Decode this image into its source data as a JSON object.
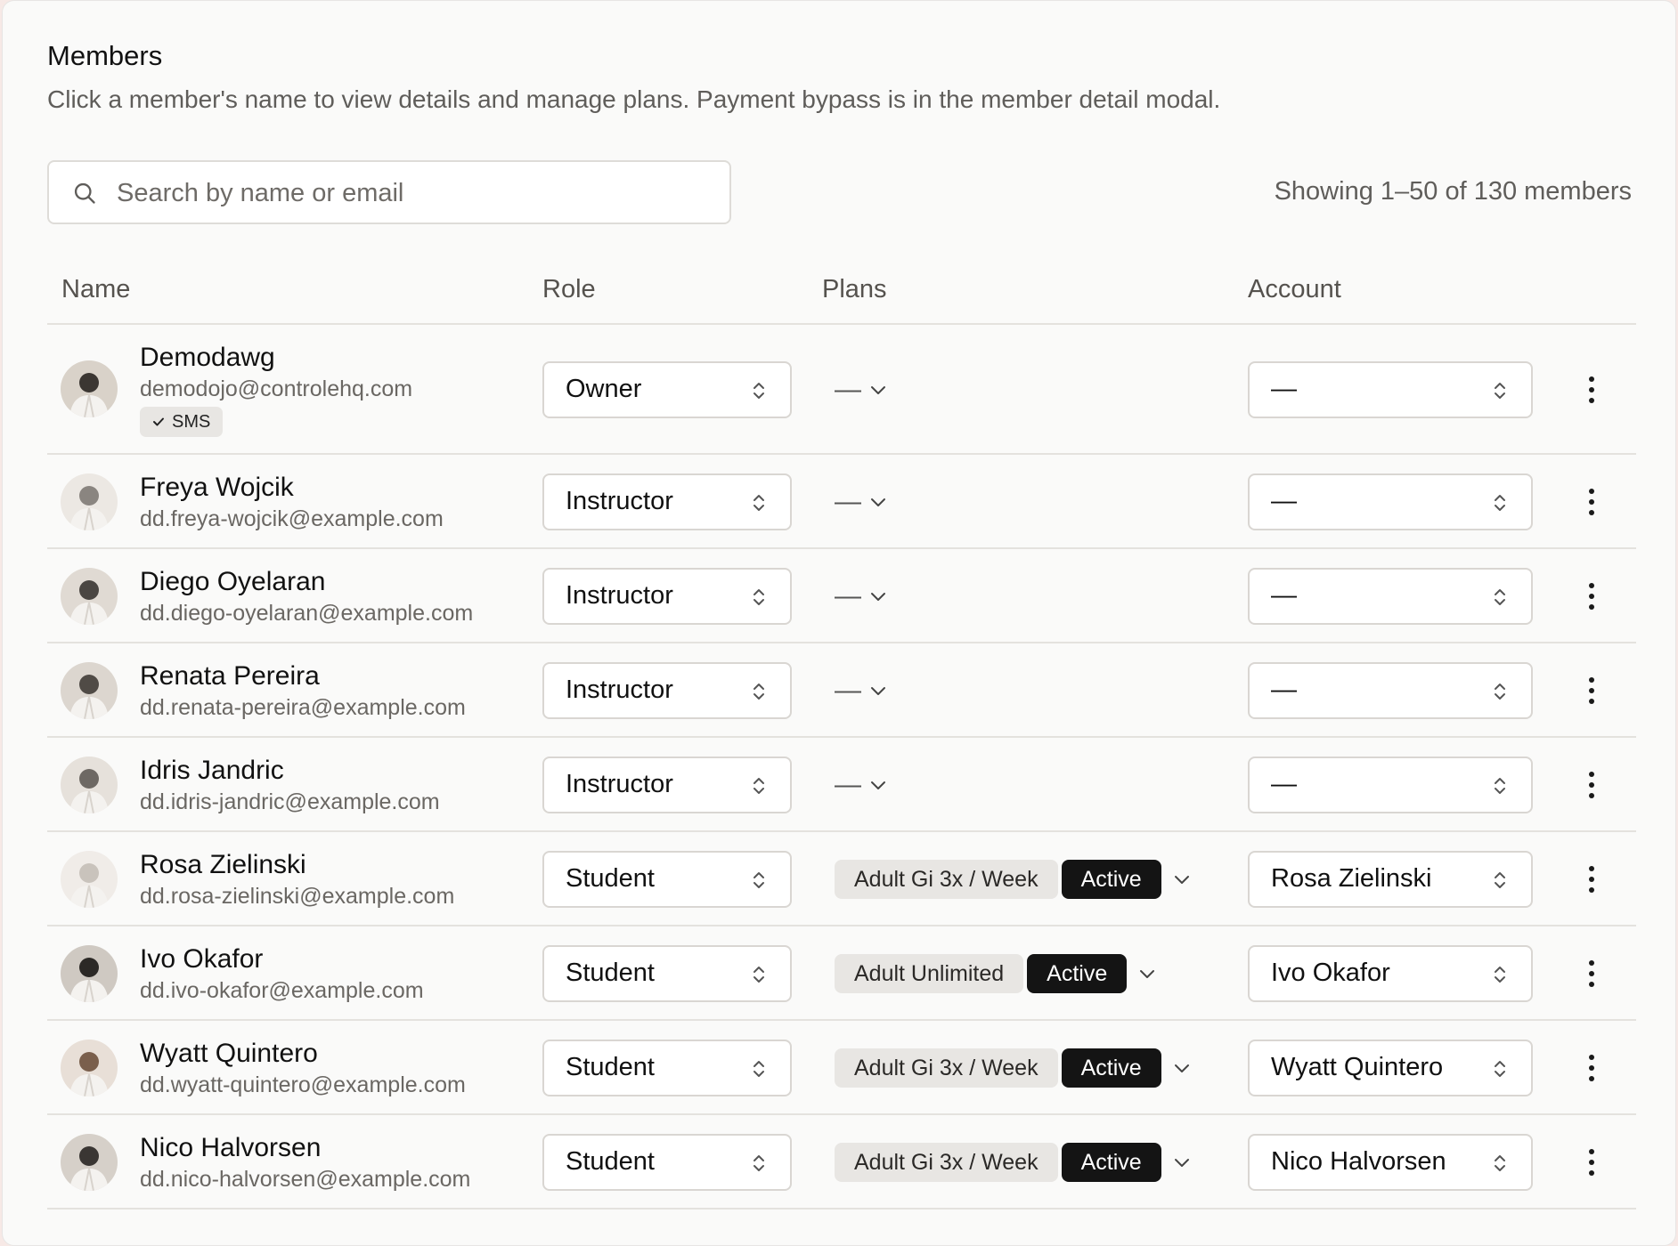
{
  "page": {
    "title": "Members",
    "subtitle": "Click a member's name to view details and manage plans. Payment bypass is in the member detail modal."
  },
  "search": {
    "placeholder": "Search by name or email",
    "value": ""
  },
  "count_text": "Showing 1–50 of 130 members",
  "columns": {
    "name": "Name",
    "role": "Role",
    "plans": "Plans",
    "account": "Account"
  },
  "members": [
    {
      "name": "Demodawg",
      "email": "demodojo@controlehq.com",
      "badge": "SMS",
      "role": "Owner",
      "plan": null,
      "status": null,
      "plans_empty": "—",
      "account": "—"
    },
    {
      "name": "Freya Wojcik",
      "email": "dd.freya-wojcik@example.com",
      "role": "Instructor",
      "plan": null,
      "status": null,
      "plans_empty": "—",
      "account": "—"
    },
    {
      "name": "Diego Oyelaran",
      "email": "dd.diego-oyelaran@example.com",
      "role": "Instructor",
      "plan": null,
      "status": null,
      "plans_empty": "—",
      "account": "—"
    },
    {
      "name": "Renata Pereira",
      "email": "dd.renata-pereira@example.com",
      "role": "Instructor",
      "plan": null,
      "status": null,
      "plans_empty": "—",
      "account": "—"
    },
    {
      "name": "Idris Jandric",
      "email": "dd.idris-jandric@example.com",
      "role": "Instructor",
      "plan": null,
      "status": null,
      "plans_empty": "—",
      "account": "—"
    },
    {
      "name": "Rosa Zielinski",
      "email": "dd.rosa-zielinski@example.com",
      "role": "Student",
      "plan": "Adult Gi 3x / Week",
      "status": "Active",
      "account": "Rosa Zielinski"
    },
    {
      "name": "Ivo Okafor",
      "email": "dd.ivo-okafor@example.com",
      "role": "Student",
      "plan": "Adult Unlimited",
      "status": "Active",
      "account": "Ivo Okafor"
    },
    {
      "name": "Wyatt Quintero",
      "email": "dd.wyatt-quintero@example.com",
      "role": "Student",
      "plan": "Adult Gi 3x / Week",
      "status": "Active",
      "account": "Wyatt Quintero"
    },
    {
      "name": "Nico Halvorsen",
      "email": "dd.nico-halvorsen@example.com",
      "role": "Student",
      "plan": "Adult Gi 3x / Week",
      "status": "Active",
      "account": "Nico Halvorsen"
    }
  ],
  "icons": {
    "search": "search-icon",
    "select": "chevron-up-down-icon",
    "plan_dropdown": "chevron-down-icon",
    "row_menu": "more-vertical-icon",
    "badge_check": "check-icon"
  },
  "colors": {
    "status_active_bg": "#141414",
    "plan_pill_bg": "#e8e6e3",
    "panel_bg": "#fafaf9",
    "page_bg": "#f7e9e6"
  }
}
